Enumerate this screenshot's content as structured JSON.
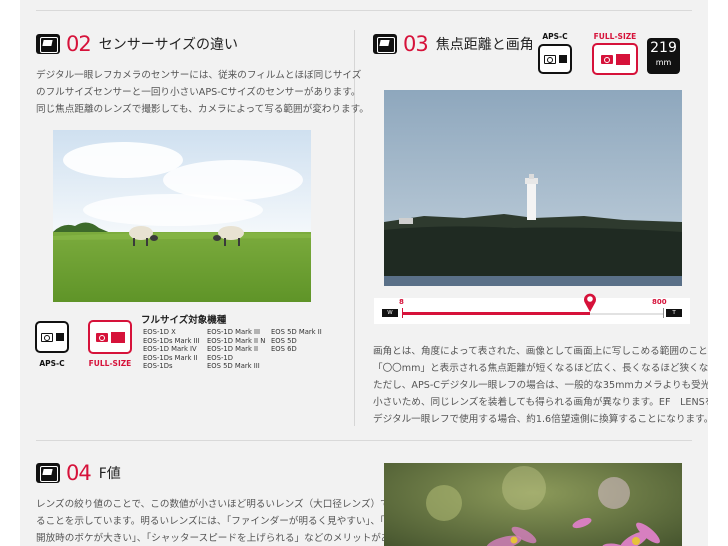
{
  "colors": {
    "accent": "#d6123a",
    "badge_dark": "#111111",
    "panel": "#f2f2f2"
  },
  "section_02": {
    "number": "02",
    "title": "センサーサイズの違い",
    "icon": "camera-screen-icon",
    "paragraph": [
      "デジタル一眼レフカメラのセンサーには、従来のフィルムとほぼ同じサイズ",
      "のフルサイズセンサーと一回り小さいAPS-Cサイズのセンサーがあります。",
      "同じ焦点距離のレンズで撮影しても、カメラによって写る範囲が変わります。"
    ],
    "badges": {
      "aps_c": "APS-C",
      "full_size": "FULL-SIZE"
    },
    "body_list_title": "フルサイズ対象機種",
    "bodies": [
      [
        "EOS-1D X",
        "EOS-1Ds Mark III",
        "EOS-1D Mark IV",
        "EOS-1Ds Mark II",
        "EOS-1Ds"
      ],
      [
        "EOS-1D Mark III",
        "EOS-1D Mark II N",
        "EOS-1D Mark II",
        "EOS-1D",
        "EOS 5D Mark III"
      ],
      [
        "EOS 5D Mark II",
        "EOS 5D",
        "EOS 6D"
      ]
    ]
  },
  "section_03": {
    "number": "03",
    "title": "焦点距離と画角",
    "icon": "camera-screen-icon",
    "badges": {
      "aps_c": "APS-C",
      "full_size": "FULL-SIZE"
    },
    "focal_badge": {
      "value": "219",
      "unit": "mm"
    },
    "zoom_slider": {
      "min_label": "8",
      "max_label": "800",
      "wide_label": "W",
      "tele_label": "T",
      "value": 219,
      "min": 8,
      "max": 800
    },
    "paragraph": [
      "画角とは、角度によって表された、画像として画面上に写しこめる範囲のこと。",
      "「〇〇mm」と表示される焦点距離が短くなるほど広く、長くなるほど狭くなります。",
      "ただし、APS-Cデジタル一眼レフの場合は、一般的な35mmカメラよりも受光部が",
      "小さいため、同じレンズを装着しても得られる画角が異なります。EF　LENSをAPS-C",
      "デジタル一眼レフで使用する場合、約1.6倍望遠側に換算することになります。"
    ]
  },
  "section_04": {
    "number": "04",
    "title": "F値",
    "icon": "camera-screen-icon",
    "paragraph": [
      "レンズの絞り値のことで、この数値が小さいほど明るいレンズ（大口径レンズ）であ",
      "ることを示しています。明るいレンズには、「ファインダーが明るく見やすい」、「絞り",
      "開放時のボケが大きい」、「シャッタースピードを上げられる」などのメリットがあり"
    ]
  }
}
